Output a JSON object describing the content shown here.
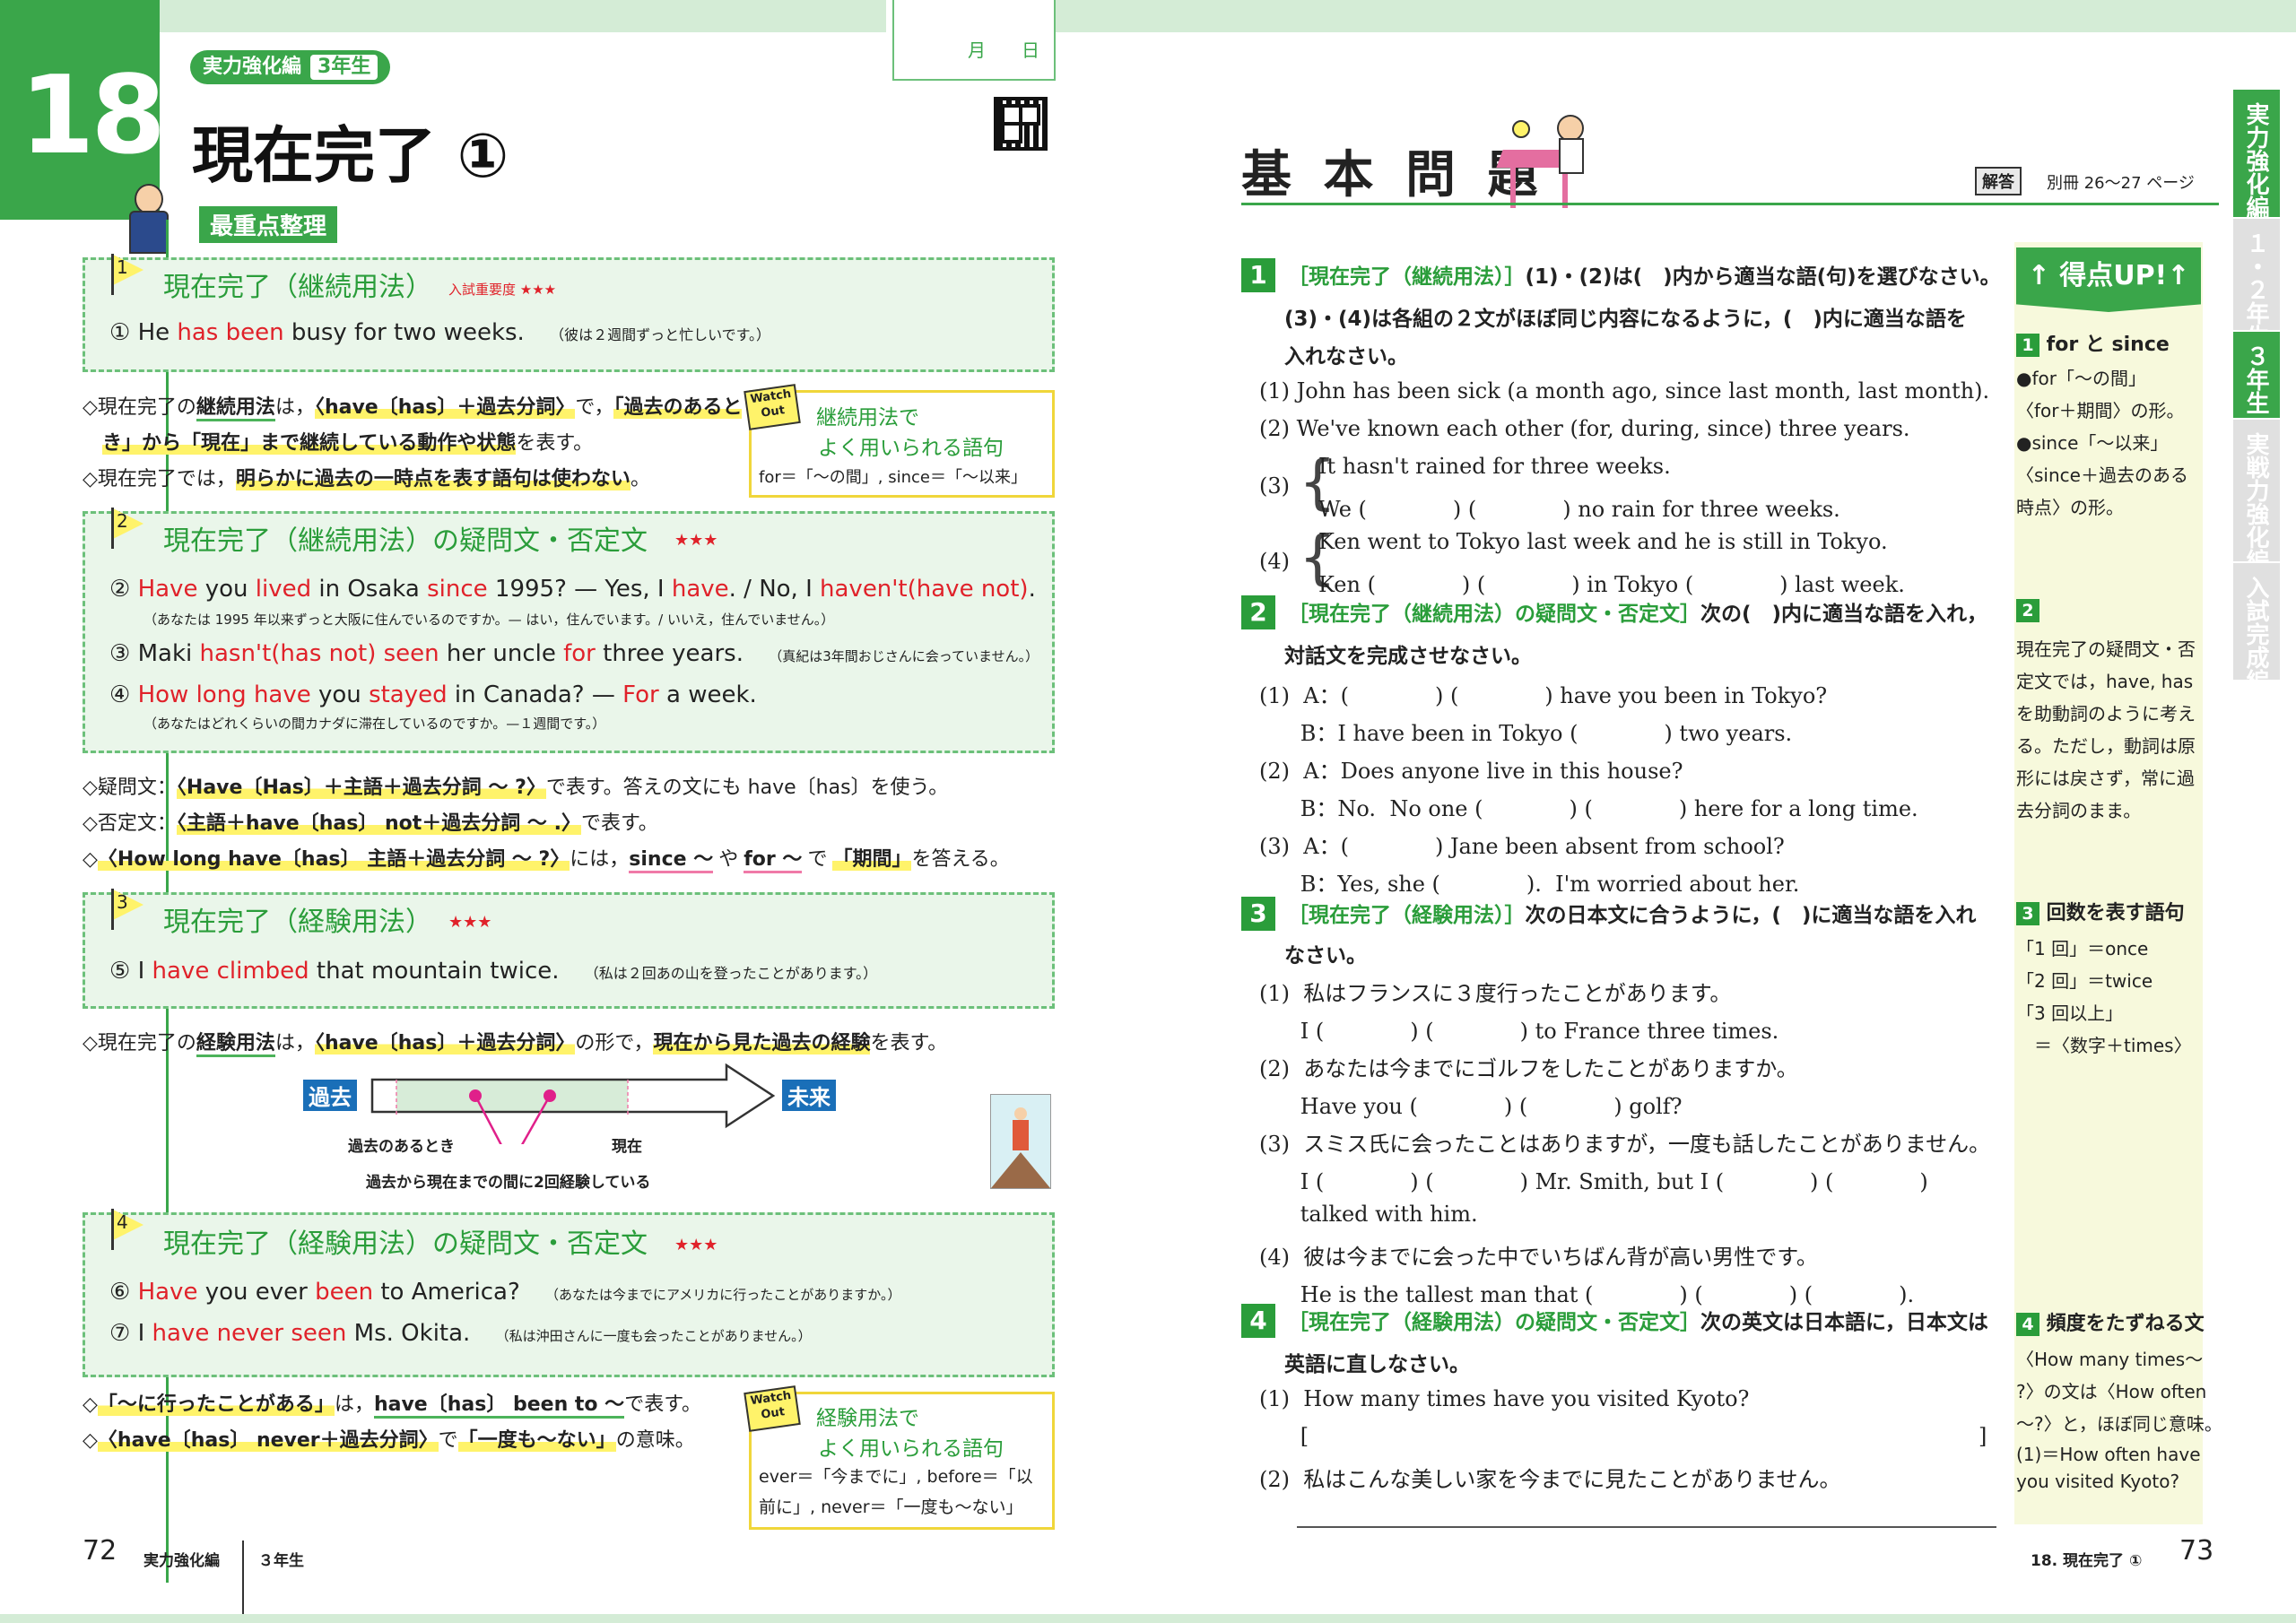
{
  "lesson": {
    "number": "18",
    "category": "実力強化編",
    "grade": "3年生",
    "title": "現在完了 ①",
    "date_month": "月",
    "date_day": "日",
    "summary_label": "最重点整理"
  },
  "left": {
    "point1": {
      "num": "1",
      "title": "現在完了（継続用法）",
      "importance": "入試重要度 ★★★",
      "example": {
        "circ": "①",
        "w1": "He",
        "w2": "has been",
        "w3": "busy for two weeks.",
        "jp": "（彼は２週間ずっと忙しいです。）"
      }
    },
    "notes1": [
      [
        "◇現在完了の",
        "継続用法",
        "は，",
        "〈have〔has〕＋過去分詞〉",
        "で，",
        "「過去のあると"
      ],
      [
        "き」から",
        "「現在」",
        "まで継続している動作や状態",
        "を表す。"
      ],
      [
        "◇現在完了では，",
        "明らかに過去の一時点を表す語句は使わない",
        "。"
      ]
    ],
    "watch1": {
      "tag1": "Watch",
      "tag2": "Out",
      "title1": "継続用法で",
      "title2": "よく用いられる語句",
      "body": "for＝「～の間」, since＝「～以来」"
    },
    "point2": {
      "num": "2",
      "title": "現在完了（継続用法）の疑問文・否定文",
      "stars": "★★★",
      "ex2": {
        "circ": "②",
        "t": [
          "Have",
          " you ",
          "lived",
          " in Osaka ",
          "since",
          " 1995? — Yes, I ",
          "have",
          ".",
          " / No, I ",
          "haven't(have not)",
          "."
        ],
        "jp": "（あなたは 1995 年以来ずっと大阪に住んでいるのですか。— はい，住んでいます。/ いいえ，住んでいません。）"
      },
      "ex3": {
        "circ": "③",
        "t": [
          "Maki ",
          "hasn't(has not)",
          " ",
          "seen",
          " her uncle ",
          "for",
          " three years."
        ],
        "jp": "（真紀は3年間おじさんに会っていません。）"
      },
      "ex4": {
        "circ": "④",
        "t": [
          "How long have",
          " you ",
          "stayed",
          " in Canada? — ",
          "For",
          " a week."
        ],
        "jp": "（あなたはどれくらいの間カナダに滞在しているのですか。—１週間です。）"
      }
    },
    "notes2": [
      [
        "◇疑問文：",
        "〈Have〔Has〕＋主語＋過去分詞 ～ ?〉",
        "で表す。答えの文にも have〔has〕を使う。"
      ],
      [
        "◇否定文：",
        "〈主語＋have〔has〕 not＋過去分詞 ～ .〉",
        "で表す。"
      ],
      [
        "◇",
        "〈How long have〔has〕 主語＋過去分詞 ～ ?〉",
        "には，",
        "since ～",
        "や",
        "for ～",
        "で",
        "「期間」",
        "を答える。"
      ]
    ],
    "point3": {
      "num": "3",
      "title": "現在完了（経験用法）",
      "stars": "★★★",
      "ex5": {
        "circ": "⑤",
        "t": [
          "I ",
          "have climbed",
          " that mountain twice."
        ],
        "jp": "（私は２回あの山を登ったことがあります。）"
      }
    },
    "notes3": [
      "◇現在完了の",
      "経験用法",
      "は，",
      "〈have〔has〕＋過去分詞〉",
      "の形で，",
      "現在から見た過去の経験",
      "を表す。"
    ],
    "timeline": {
      "past": "過去",
      "future": "未来",
      "label_past": "過去のあるとき",
      "label_now": "現在",
      "caption": "過去から現在までの間に2回経験している"
    },
    "point4": {
      "num": "4",
      "title": "現在完了（経験用法）の疑問文・否定文",
      "stars": "★★★",
      "ex6": {
        "circ": "⑥",
        "t": [
          "Have",
          " you ever ",
          "been",
          " to America?"
        ],
        "jp": "（あなたは今までにアメリカに行ったことがありますか。）"
      },
      "ex7": {
        "circ": "⑦",
        "t": [
          "I ",
          "have never seen",
          " Ms. Okita."
        ],
        "jp": "（私は沖田さんに一度も会ったことがありません。）"
      }
    },
    "notes4": [
      [
        "◇",
        "「～に行ったことがある」",
        "は，",
        "have〔has〕 been to ～",
        "で表す。"
      ],
      [
        "◇",
        "〈have〔has〕 never＋過去分詞〉",
        "で",
        "「一度も～ない」",
        "の意味。"
      ]
    ],
    "watch2": {
      "tag1": "Watch",
      "tag2": "Out",
      "title1": "経験用法で",
      "title2": "よく用いられる語句",
      "body1": "ever＝「今までに」, before＝「以",
      "body2": "前に」, never＝「一度も～ない」"
    },
    "footer": {
      "page": "72",
      "book": "実力強化編",
      "grade": "３年生"
    }
  },
  "right": {
    "heading": "基 本 問 題",
    "answer_tag": "解答",
    "answer_ref": "別冊 26～27 ページ",
    "q1": {
      "num": "1",
      "instr1": [
        "［現在完了（継続用法）］",
        "(1)・(2)は(　)内から適当な語(句)を選びなさい。"
      ],
      "instr2": "(3)・(4)は各組の２文がほぼ同じ内容になるように，(　)内に適当な語を",
      "instr3": "入れなさい。",
      "items": [
        "(1)  John has been sick (a month ago, since last month, last month).",
        "(2)  We've known each other (for, during, since) three years."
      ],
      "i3a": "It hasn't rained for three weeks.",
      "i3b": "We (　　　　) (　　　　) no rain for three weeks.",
      "i3n": "(3)",
      "i4a": "Ken went to Tokyo last week and he is still in Tokyo.",
      "i4b": "Ken (　　　　) (　　　　) in Tokyo (　　　　) last week.",
      "i4n": "(4)"
    },
    "q2": {
      "num": "2",
      "instr1": [
        "［現在完了（継続用法）の疑問文・否定文］",
        "次の(　)内に適当な語を入れ，"
      ],
      "instr2": "対話文を完成させなさい。",
      "lines": [
        "(1)  A：(　　　　) (　　　　) have you been in Tokyo?",
        "      B：I have been in Tokyo (　　　　) two years.",
        "(2)  A：Does anyone live in this house?",
        "      B：No.  No one (　　　　) (　　　　) here for a long time.",
        "(3)  A：(　　　　) Jane been absent from school?",
        "      B：Yes, she (　　　　).  I'm worried about her."
      ]
    },
    "q3": {
      "num": "3",
      "instr1": [
        "［現在完了（経験用法）］",
        "次の日本文に合うように，(　)に適当な語を入れ"
      ],
      "instr2": "なさい。",
      "lines": [
        "(1)  私はフランスに３度行ったことがあります。",
        "      I (　　　　) (　　　　) to France three times.",
        "(2)  あなたは今までにゴルフをしたことがありますか。",
        "      Have you (　　　　) (　　　　) golf?",
        "(3)  スミス氏に会ったことはありますが，一度も話したことがありません。",
        "      I (　　　　) (　　　　) Mr. Smith, but I (　　　　) (　　　　)",
        "      talked with him.",
        "(4)  彼は今までに会った中でいちばん背が高い男性です。",
        "      He is the tallest man that (　　　　) (　　　　) (　　　　)."
      ]
    },
    "q4": {
      "num": "4",
      "instr1": [
        "［現在完了（経験用法）の疑問文・否定文］",
        "次の英文は日本語に，日本文は"
      ],
      "instr2": "英語に直しなさい。",
      "lines": [
        "(1)  How many times have you visited Kyoto?",
        "      [",
        "(2)  私はこんな美しい家を今までに見たことがありません。"
      ],
      "bracket_close": "]"
    },
    "side": {
      "banner": "↑ 得点UP!↑",
      "s1": {
        "num": "1",
        "title": "for と since",
        "lines": [
          "●for「～の間」",
          "〈for＋期間〉の形。",
          "●since「～以来」",
          "〈since＋過去のある",
          "時点〉の形。"
        ]
      },
      "s2": {
        "num": "2",
        "lines": [
          "現在完了の疑問文・否",
          "定文では，have, has",
          "を助動詞のように考え",
          "る。ただし，動詞は原",
          "形には戻さず，常に過",
          "去分詞のまま。"
        ]
      },
      "s3": {
        "num": "3",
        "title": "回数を表す語句",
        "lines": [
          "「1 回」＝once",
          "「2 回」＝twice",
          "「3 回以上」",
          "　＝〈数字＋times〉"
        ]
      },
      "s4": {
        "num": "4",
        "title": "頻度をたずねる文",
        "lines": [
          "〈How many times～",
          "?〉の文は〈How often",
          "～?〉と，ほぼ同じ意味。",
          "(1)＝How often have",
          "you visited Kyoto?"
        ]
      }
    },
    "tabs": [
      "実力強化編",
      "１・２年生",
      "３年生",
      "実戦力強化編",
      "入試完成編"
    ],
    "footer": {
      "title": "18. 現在完了 ①",
      "page": "73"
    }
  }
}
